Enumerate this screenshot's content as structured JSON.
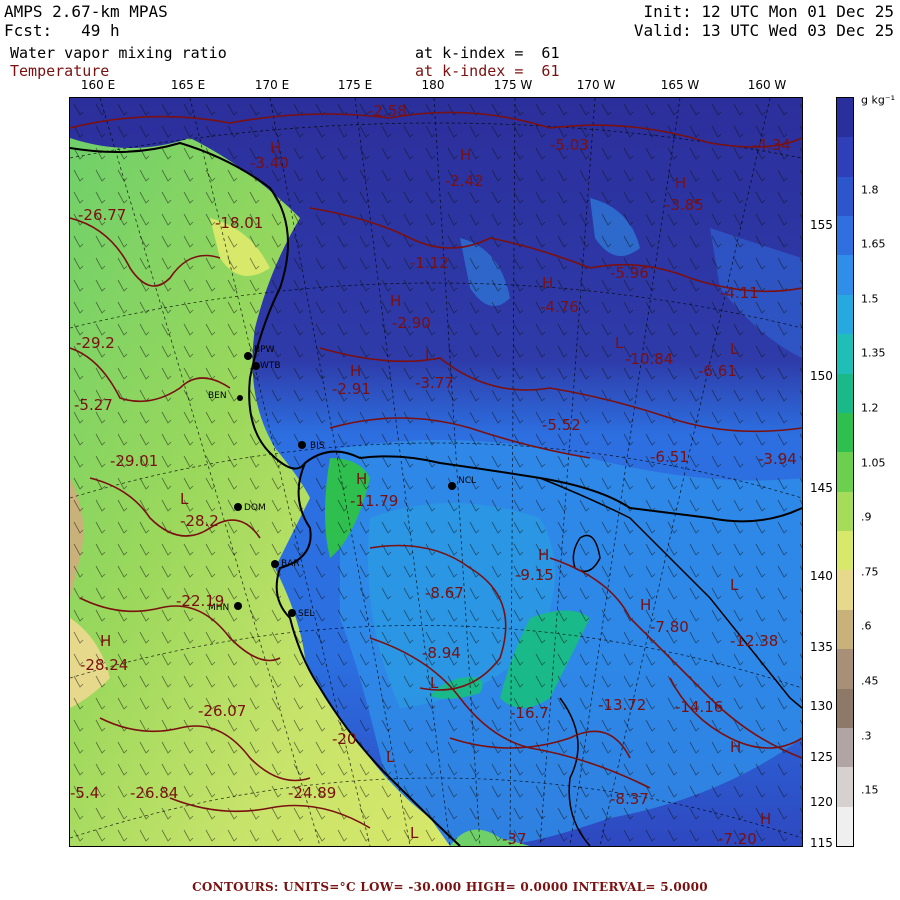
{
  "header": {
    "model": "AMPS 2.67-km MPAS",
    "forecast": "Fcst:   49 h",
    "init": "Init: 12 UTC Mon 01 Dec 25",
    "valid": "Valid: 13 UTC Wed 03 Dec 25",
    "field1_name": "Water vapor mixing ratio",
    "field1_level": "at k-index =  61",
    "field2_name": "Temperature",
    "field2_level": "at k-index =  61"
  },
  "longitude_labels": [
    "160 E",
    "165 E",
    "170 E",
    "175 E",
    "180",
    "175 W",
    "170 W",
    "165 W",
    "160 W"
  ],
  "latitude_labels": [
    "155",
    "150",
    "145",
    "140",
    "135",
    "130",
    "125",
    "120",
    "115"
  ],
  "colorbar": {
    "unit": "g kg⁻¹",
    "labels": [
      "1.8",
      "1.65",
      "1.5",
      "1.35",
      "1.2",
      "1.05",
      ".9",
      ".75",
      ".6",
      ".45",
      ".3",
      ".15"
    ],
    "colors": [
      "#2a2f9e",
      "#2f3fb8",
      "#2d55cc",
      "#2f6fe0",
      "#2f8ee8",
      "#27a9e0",
      "#1fbfb8",
      "#19b98a",
      "#2fbf4f",
      "#6ccf4e",
      "#a6dc5a",
      "#d8e86a",
      "#e6d98c",
      "#c9b27a",
      "#a89078",
      "#8e7868",
      "#b0a4a4",
      "#d6d0d0",
      "#efefef"
    ]
  },
  "stations": [
    "BPW",
    "WTB",
    "BEN",
    "BIS",
    "NCL",
    "DOM",
    "BAR",
    "MHN",
    "SEL"
  ],
  "temperature_labels": [
    "-2.58",
    "-5.03",
    "-4.34",
    "-3.40",
    "-2.42",
    "-3.85",
    "-26.77",
    "-18.01",
    "-4.11",
    "-5.96",
    "-1.12",
    "-4.76",
    "-2.90",
    "-3.77",
    "-10.84",
    "-6.61",
    "-29.2",
    "-2.91",
    "-5.27",
    "-5.52",
    "-6.51",
    "-3.94",
    "-29.01",
    "-11.79",
    "-28.2",
    "-9.15",
    "-22.19",
    "-8.67",
    "-8.94",
    "-7.80",
    "-12.38",
    "-28.24",
    "-16.7",
    "-13.72",
    "-14.16",
    "-26.07",
    "-20",
    "-26.84",
    "-24.89",
    "-5.4",
    "-8.37",
    "-7.20",
    "-37"
  ],
  "footer": "CONTOURS:  UNITS=°C  LOW= -30.000      HIGH=  0.0000      INTERVAL=   5.0000"
}
